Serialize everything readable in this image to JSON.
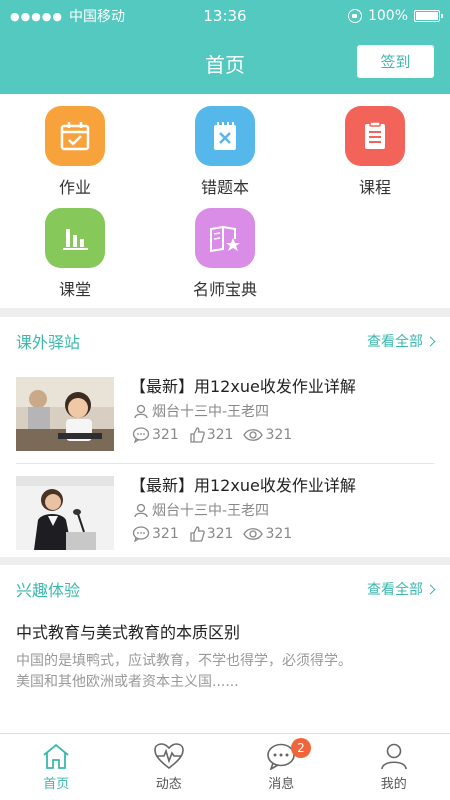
{
  "status_bar": {
    "carrier": "中国移动",
    "time": "13:36",
    "battery": "100%"
  },
  "nav": {
    "title": "首页",
    "checkin_label": "签到"
  },
  "grid": [
    {
      "label": "作业",
      "icon": "calendar-icon",
      "color": "#f8a23c"
    },
    {
      "label": "错题本",
      "icon": "notepad-icon",
      "color": "#56b7ea"
    },
    {
      "label": "课程",
      "icon": "list-icon",
      "color": "#f2645a"
    },
    {
      "label": "课堂",
      "icon": "bar-chart-icon",
      "color": "#86c95a"
    },
    {
      "label": "名师宝典",
      "icon": "book-star-icon",
      "color": "#d98de6"
    }
  ],
  "outside": {
    "title": "课外驿站",
    "more": "查看全部",
    "articles": [
      {
        "title": "【最新】用12xue收发作业详解",
        "author": "烟台十三中-王老四",
        "comments": "321",
        "likes": "321",
        "views": "321"
      },
      {
        "title": "【最新】用12xue收发作业详解",
        "author": "烟台十三中-王老四",
        "comments": "321",
        "likes": "321",
        "views": "321"
      }
    ]
  },
  "interest": {
    "title": "兴趣体验",
    "more": "查看全部",
    "headline": "中式教育与美式教育的本质区别",
    "excerpt_line1": "中国的是填鸭式，应试教育，不学也得学，必须得学。",
    "excerpt_line2": "美国和其他欧洲或者资本主义国......"
  },
  "tabs": [
    {
      "label": "首页",
      "icon": "home-icon",
      "active": true
    },
    {
      "label": "动态",
      "icon": "heartbeat-icon"
    },
    {
      "label": "消息",
      "icon": "message-icon",
      "badge": "2"
    },
    {
      "label": "我的",
      "icon": "user-icon"
    }
  ],
  "colors": {
    "primary": "#53c9c0",
    "accent_text": "#3bb8ad",
    "badge": "#f0643c"
  }
}
